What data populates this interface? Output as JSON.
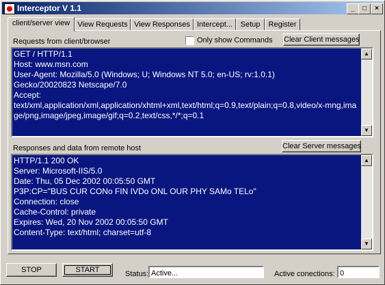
{
  "window": {
    "title": "Interceptor V 1.1",
    "minimize": "_",
    "maximize": "□",
    "close": "×"
  },
  "tabs": [
    {
      "label": "client/server view",
      "active": true
    },
    {
      "label": "View Requests"
    },
    {
      "label": "View Responses"
    },
    {
      "label": "Intercept..."
    },
    {
      "label": "Setup"
    },
    {
      "label": "Register"
    }
  ],
  "requests": {
    "label": "Requests from client/browser",
    "only_show_commands": "Only show Commands",
    "clear_button": "Clear Client messages",
    "text": "GET / HTTP/1.1\nHost: www.msn.com\nUser-Agent: Mozilla/5.0 (Windows; U; Windows NT 5.0; en-US; rv:1.0.1)\nGecko/20020823 Netscape/7.0\nAccept:\ntext/xml,application/xml,application/xhtml+xml,text/html;q=0.9,text/plain;q=0.8,video/x-mng,image/png,image/jpeg,image/gif;q=0.2,text/css,*/*;q=0.1"
  },
  "responses": {
    "label": "Responses and data from remote host",
    "clear_button": "Clear Server messages",
    "text": "HTTP/1.1 200 OK\nServer: Microsoft-IIS/5.0\nDate: Thu, 05 Dec 2002 00:05:50 GMT\nP3P:CP=\"BUS CUR CONo FIN IVDo ONL OUR PHY SAMo TELo\"\nConnection: close\nCache-Control: private\nExpires: Wed, 20 Nov 2002 00:05:50 GMT\nContent-Type: text/html; charset=utf-8"
  },
  "bottom": {
    "stop": "STOP",
    "start": "START",
    "status_label": "Status:",
    "status_value": "Active...",
    "active_connections_label": "Active conections:",
    "active_connections_value": "0"
  }
}
